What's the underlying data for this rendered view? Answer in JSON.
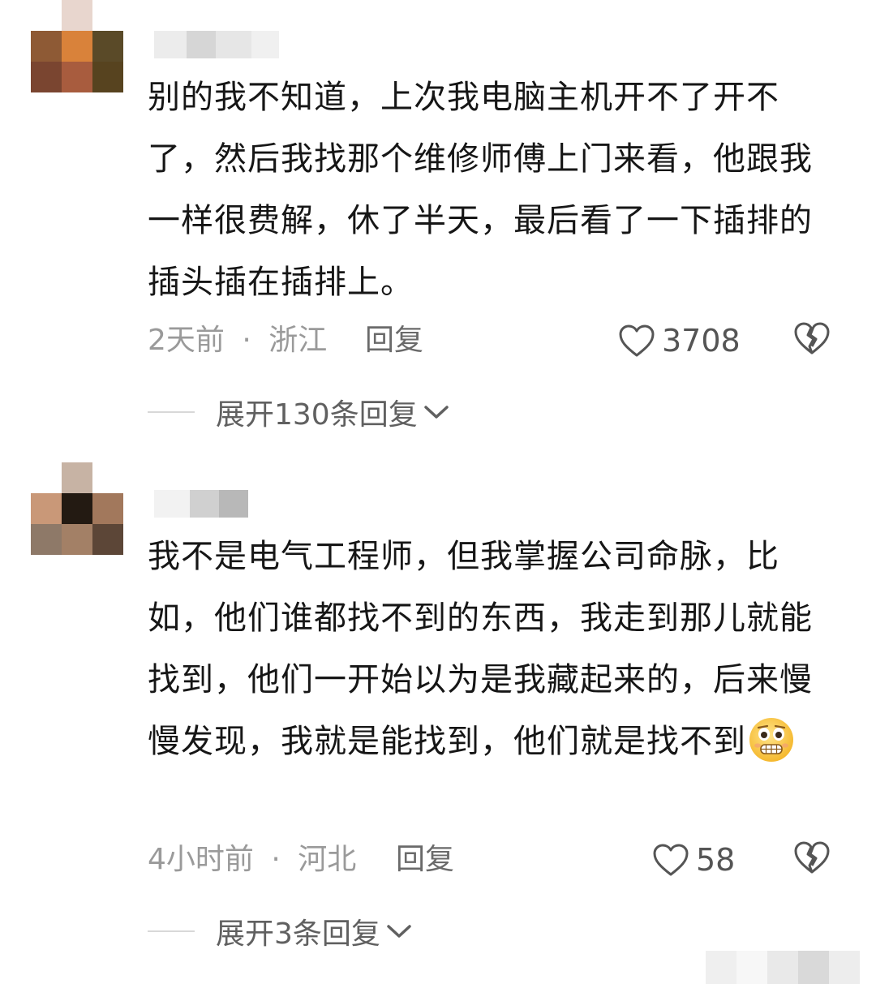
{
  "comments": [
    {
      "text": "别的我不知道，上次我电脑主机开不了开不了，然后我找那个维修师傅上门来看，他跟我一样很费解，休了半天，最后看了一下插排的插头插在插排上。",
      "time": "2天前",
      "separator": "·",
      "location": "浙江",
      "reply_label": "回复",
      "likes": "3708",
      "expand_label": "展开130条回复",
      "avatar_colors": [
        "#ffffff",
        "#e8d6ce",
        "#ffffff",
        "#8e5a35",
        "#d9823a",
        "#5a4a28",
        "#7a4530",
        "#a85c3e",
        "#57431f"
      ],
      "username_colors": [
        "#ececec",
        "#d6d6d6",
        "#e6e6e6",
        "#f0f0f0"
      ]
    },
    {
      "text": "我不是电气工程师，但我掌握公司命脉，比如，他们谁都找不到的东西，我走到那儿就能找到，他们一开始以为是我藏起来的，后来慢慢发现，我就是能找到，他们就是找不到",
      "time": "4小时前",
      "separator": "·",
      "location": "河北",
      "reply_label": "回复",
      "likes": "58",
      "expand_label": "展开3条回复",
      "emoji": "grimacing-face-emoji",
      "avatar_colors": [
        "#ffffff",
        "#c7b3a4",
        "#ffffff",
        "#c99878",
        "#231a12",
        "#a2785c",
        "#8e7968",
        "#a38066",
        "#5c4637"
      ],
      "username_colors": [
        "#f2f2f2",
        "#d0d0d0",
        "#b8b8b8"
      ]
    }
  ],
  "icons": {
    "like": "heart-outline-icon",
    "dislike": "broken-heart-icon",
    "expand": "chevron-down-icon"
  },
  "colors": {
    "text": "#161616",
    "meta": "#9a9a9a",
    "reply": "#6a6a6a",
    "divider": "#d8d8d8"
  }
}
